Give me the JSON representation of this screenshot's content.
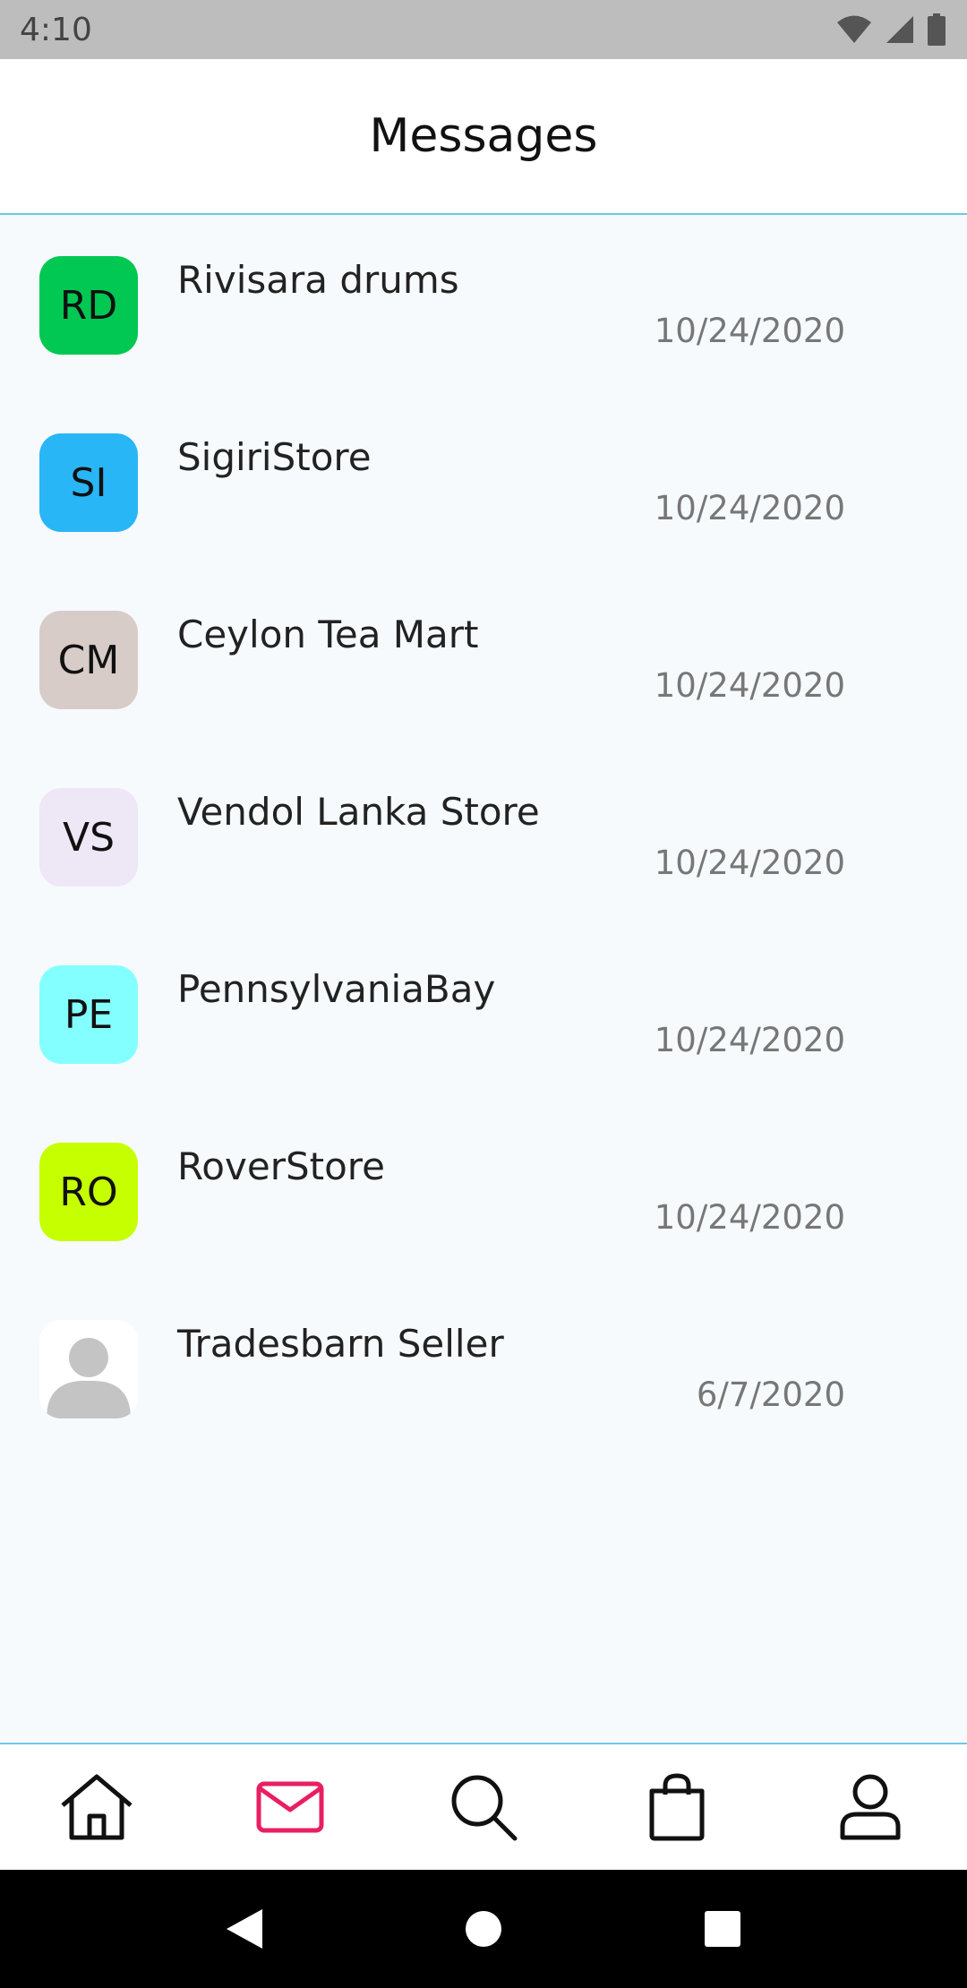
{
  "status_bar": {
    "time": "4:10"
  },
  "header": {
    "title": "Messages"
  },
  "conversations": [
    {
      "initials": "RD",
      "name": "Rivisara drums",
      "date": "10/24/2020",
      "color": "#00c853"
    },
    {
      "initials": "SI",
      "name": "SigiriStore",
      "date": "10/24/2020",
      "color": "#29b6f6"
    },
    {
      "initials": "CM",
      "name": "Ceylon Tea Mart",
      "date": "10/24/2020",
      "color": "#d7ccc8"
    },
    {
      "initials": "VS",
      "name": "Vendol Lanka Store",
      "date": "10/24/2020",
      "color": "#ede7f6"
    },
    {
      "initials": "PE",
      "name": "PennsylvaniaBay",
      "date": "10/24/2020",
      "color": "#84ffff"
    },
    {
      "initials": "RO",
      "name": "RoverStore",
      "date": "10/24/2020",
      "color": "#c6ff00"
    },
    {
      "initials": "",
      "name": "Tradesbarn Seller",
      "date": "6/7/2020",
      "color": "#ffffff"
    }
  ],
  "bottom_nav": {
    "items": [
      "home-icon",
      "mail-icon",
      "search-icon",
      "shopping-bag-icon",
      "user-icon"
    ],
    "active": "mail-icon",
    "active_color": "#e91e63"
  },
  "colors": {
    "accent_line": "#6fc6e6"
  }
}
